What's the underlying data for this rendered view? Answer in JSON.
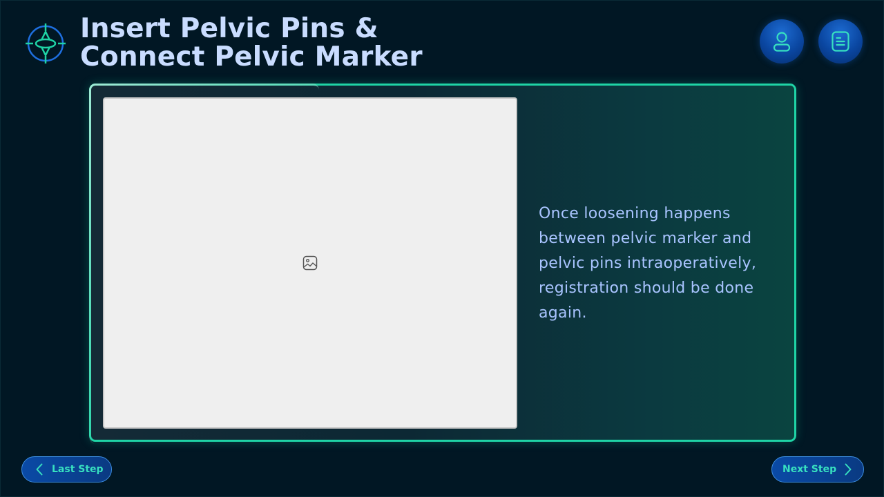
{
  "header": {
    "title_line1": "Insert Pelvic Pins &",
    "title_line2": "Connect Pelvic Marker"
  },
  "icons": {
    "logo": "navigation-target-icon",
    "profile": "user-icon",
    "document": "document-icon",
    "image_placeholder": "image-icon"
  },
  "main": {
    "description": "Once loosening happens between pelvic marker and pelvic pins intraoperatively, registration should be done again."
  },
  "footer": {
    "prev_label": "Last Step",
    "next_label": "Next Step"
  },
  "colors": {
    "background": "#011724",
    "title": "#c9dcff",
    "accent_green": "#1fd4a6",
    "button_blue": "#0a46a0",
    "body_text": "#a9c4ff",
    "button_text": "#37e0c0"
  }
}
